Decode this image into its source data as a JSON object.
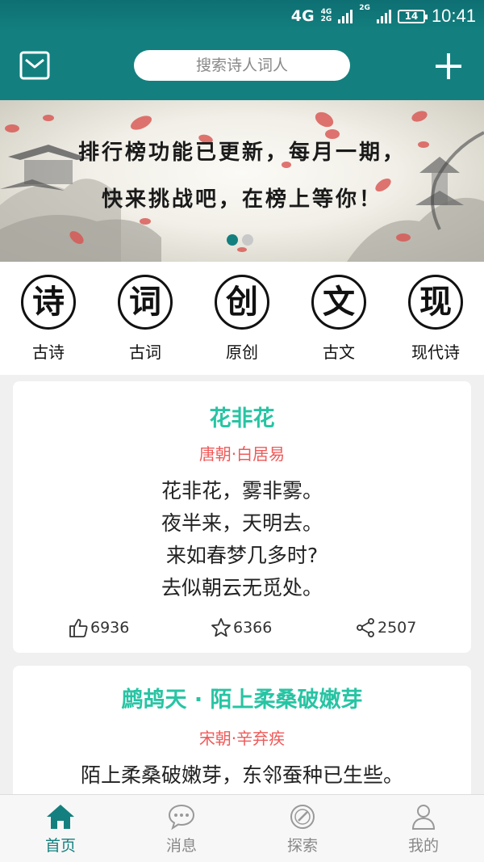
{
  "status_bar": {
    "network_primary": "4G",
    "network_secondary_top": "4G",
    "network_secondary_bottom": "2G",
    "network_tertiary": "2G",
    "battery": "14",
    "time": "10:41"
  },
  "header": {
    "search_placeholder": "搜索诗人词人"
  },
  "banner": {
    "line1": "排行榜功能已更新，每月一期，",
    "line2": "快来挑战吧，在榜上等你！",
    "page_count": 2,
    "active_page": 1
  },
  "categories": [
    {
      "glyph": "诗",
      "label": "古诗"
    },
    {
      "glyph": "词",
      "label": "古词"
    },
    {
      "glyph": "创",
      "label": "原创"
    },
    {
      "glyph": "文",
      "label": "古文"
    },
    {
      "glyph": "现",
      "label": "现代诗"
    }
  ],
  "poems": [
    {
      "title": "花非花",
      "author": "唐朝·白居易",
      "lines": [
        "花非花，雾非雾。",
        "夜半来，天明去。",
        "来如春梦几多时?",
        "去似朝云无觅处。"
      ],
      "likes": "6936",
      "favorites": "6366",
      "shares": "2507"
    },
    {
      "title": "鹧鸪天 · 陌上柔桑破嫩芽",
      "author": "宋朝·辛弃疾",
      "lines": [
        "陌上柔桑破嫩芽，东邻蚕种已生些。"
      ]
    }
  ],
  "bottom_nav": [
    {
      "label": "首页",
      "icon": "home-icon",
      "active": true
    },
    {
      "label": "消息",
      "icon": "chat-icon",
      "active": false
    },
    {
      "label": "探索",
      "icon": "compass-icon",
      "active": false
    },
    {
      "label": "我的",
      "icon": "user-icon",
      "active": false
    }
  ],
  "colors": {
    "primary": "#13807f",
    "title_green": "#27c4a3",
    "author_red": "#ef5a5a"
  }
}
